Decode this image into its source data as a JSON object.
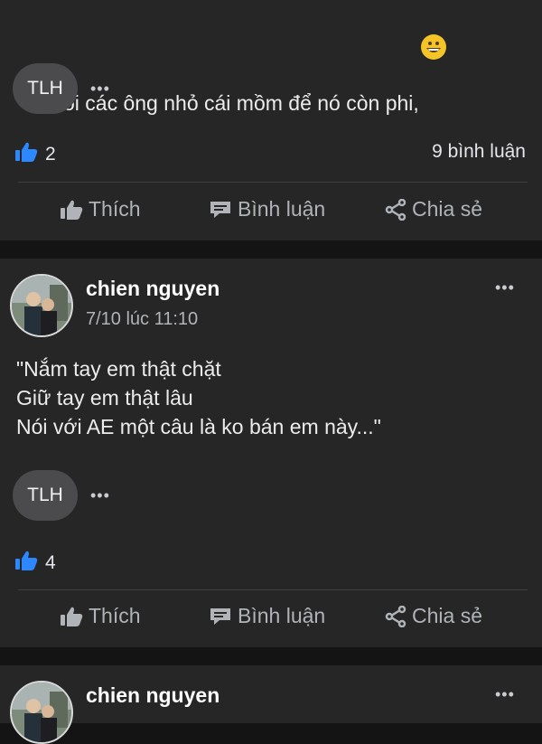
{
  "post1": {
    "text": "Thôi các ông nhỏ cái mồm để nó còn phi,",
    "emoji": "grinning-face-emoji",
    "reactor_initials": "TLH",
    "more": "•••",
    "like_count": "2",
    "comments": "9 bình luận"
  },
  "post2": {
    "author": "chien nguyen",
    "time": "7/10 lúc 11:10",
    "more": "•••",
    "lines": [
      "\"Nắm tay em thật chặt",
      "Giữ tay em thật lâu",
      "Nói với AE một câu là ko bán em này...\""
    ],
    "reactor_initials": "TLH",
    "reactor_more": "•••",
    "like_count": "4"
  },
  "post3": {
    "author": "chien nguyen",
    "more": "•••"
  },
  "actions": {
    "like": "Thích",
    "comment": "Bình luận",
    "share": "Chia sẻ"
  },
  "colors": {
    "card": "#262627",
    "background": "#141415",
    "like_blue": "#2d88ff",
    "muted": "#b0b3b8"
  }
}
